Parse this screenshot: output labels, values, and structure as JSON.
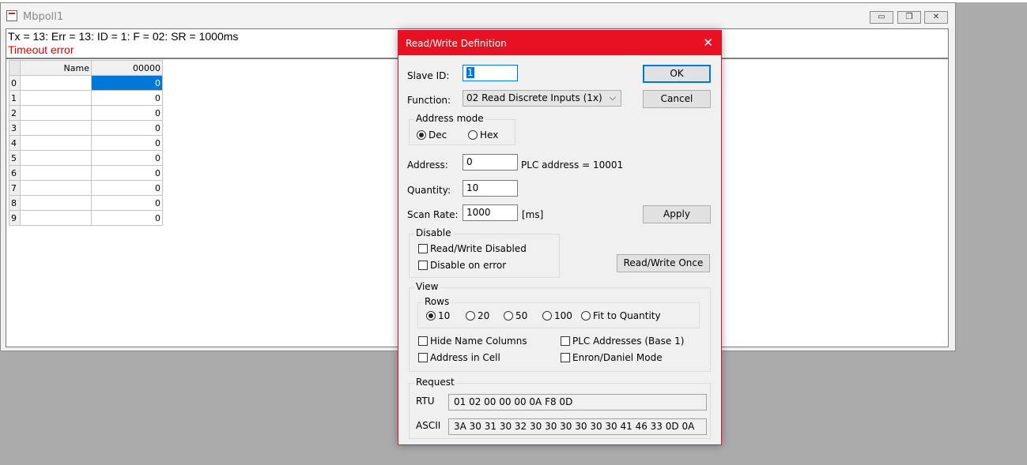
{
  "mdi": {
    "title": "Mbpoll1",
    "minimize_glyph": "▭",
    "restore_glyph": "❐",
    "close_glyph": "✕"
  },
  "status": {
    "line1": "Tx = 13: Err = 13: ID = 1: F = 02: SR = 1000ms",
    "line2": "Timeout error",
    "error_color": "#e00000"
  },
  "grid": {
    "col_name": "Name",
    "col_value": "00000",
    "rows": [
      {
        "index": "0",
        "name": "",
        "value": "0"
      },
      {
        "index": "1",
        "name": "",
        "value": "0"
      },
      {
        "index": "2",
        "name": "",
        "value": "0"
      },
      {
        "index": "3",
        "name": "",
        "value": "0"
      },
      {
        "index": "4",
        "name": "",
        "value": "0"
      },
      {
        "index": "5",
        "name": "",
        "value": "0"
      },
      {
        "index": "6",
        "name": "",
        "value": "0"
      },
      {
        "index": "7",
        "name": "",
        "value": "0"
      },
      {
        "index": "8",
        "name": "",
        "value": "0"
      },
      {
        "index": "9",
        "name": "",
        "value": "0"
      }
    ]
  },
  "dialog": {
    "title": "Read/Write Definition",
    "close_glyph": "✕",
    "accent_color": "#e81123",
    "slave_id_label": "Slave ID:",
    "slave_id_value": "1",
    "function_label": "Function:",
    "function_value": "02 Read Discrete Inputs (1x)",
    "dropdown_glyph": "⌵",
    "address_mode_title": "Address mode",
    "dec_label": "Dec",
    "hex_label": "Hex",
    "address_label": "Address:",
    "address_value": "0",
    "plc_address_text": "PLC address = 10001",
    "quantity_label": "Quantity:",
    "quantity_value": "10",
    "scan_rate_label": "Scan Rate:",
    "scan_rate_value": "1000",
    "scan_rate_unit": "[ms]",
    "ok_label": "OK",
    "cancel_label": "Cancel",
    "apply_label": "Apply",
    "rw_once_label": "Read/Write Once",
    "disable_title": "Disable",
    "rw_disabled_label": "Read/Write Disabled",
    "disable_on_error_label": "Disable on error",
    "view_title": "View",
    "rows_title": "Rows",
    "rows_options": [
      "10",
      "20",
      "50",
      "100",
      "Fit to Quantity"
    ],
    "hide_name_label": "Hide Name Columns",
    "plc_addresses_label": "PLC Addresses (Base 1)",
    "address_in_cell_label": "Address in Cell",
    "enron_label": "Enron/Daniel Mode",
    "request_title": "Request",
    "rtu_label": "RTU",
    "rtu_value": "01 02 00 00 00 0A F8 0D",
    "ascii_label": "ASCII",
    "ascii_value": "3A 30 31 30 32 30 30 30 30 30 30 41 46 33 0D 0A"
  }
}
